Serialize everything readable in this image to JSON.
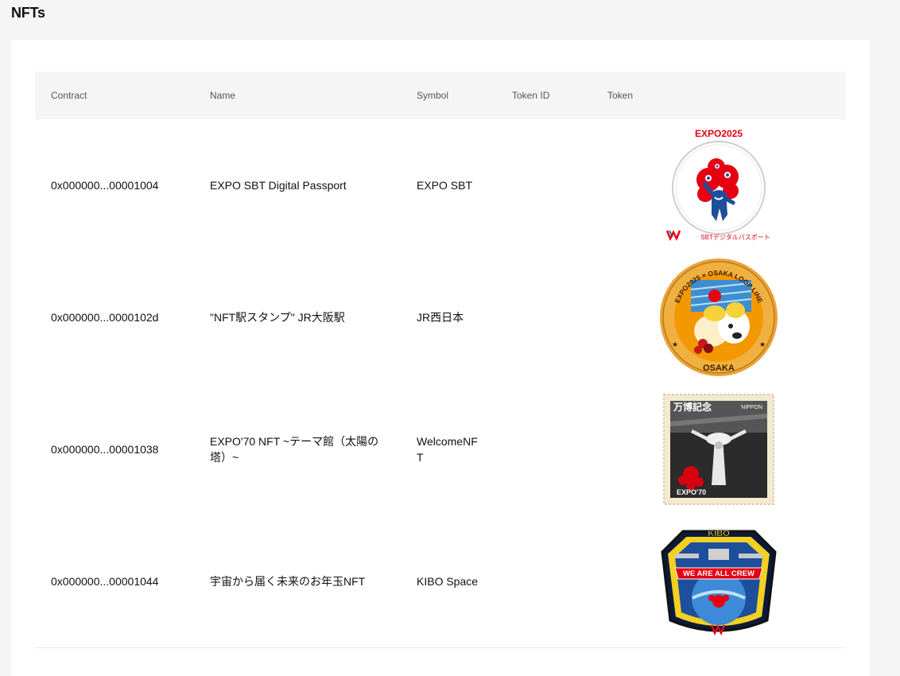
{
  "page": {
    "title": "NFTs"
  },
  "table": {
    "headers": {
      "contract": "Contract",
      "name": "Name",
      "symbol": "Symbol",
      "token_id": "Token ID",
      "token": "Token"
    },
    "rows": [
      {
        "contract": "0x000000...00001004",
        "name": "EXPO SBT Digital Passport",
        "symbol": "EXPO SBT",
        "token_id": "",
        "image": {
          "icon": "expo-sbt-passport-image",
          "top_text": "EXPO2025",
          "bottom_text": "SBTデジタルパスポート",
          "colors": {
            "red": "#e60012",
            "blue": "#1d4f9c"
          }
        }
      },
      {
        "contract": "0x000000...0000102d",
        "name": "\"NFT駅スタンプ\" JR大阪駅",
        "symbol": "JR西日本",
        "token_id": "",
        "image": {
          "icon": "jr-osaka-station-stamp-image",
          "top_text": "EXPO2025 × OSAKA LOOP LINE",
          "bottom_text": "OSAKA",
          "colors": {
            "orange": "#f39800",
            "gold": "#e8a33a"
          }
        }
      },
      {
        "contract": "0x000000...00001038",
        "name": "EXPO'70 NFT ~テーマ館（太陽の塔）~",
        "symbol": "WelcomeNFT",
        "token_id": "",
        "image": {
          "icon": "expo70-stamp-image",
          "label_nippon": "NIPPON",
          "label_expo": "EXPO'70",
          "colors": {
            "red": "#d7000f",
            "dark": "#2b2b2b"
          }
        }
      },
      {
        "contract": "0x000000...00001044",
        "name": "宇宙から届く未来のお年玉NFT",
        "symbol": "KIBO Space",
        "token_id": "",
        "image": {
          "icon": "kibo-space-patch-image",
          "top_text": "KIBO",
          "banner_text": "WE ARE ALL CREW",
          "colors": {
            "navy": "#0b1a3a",
            "blue": "#1d4f9c",
            "red": "#e60012"
          }
        }
      }
    ]
  }
}
